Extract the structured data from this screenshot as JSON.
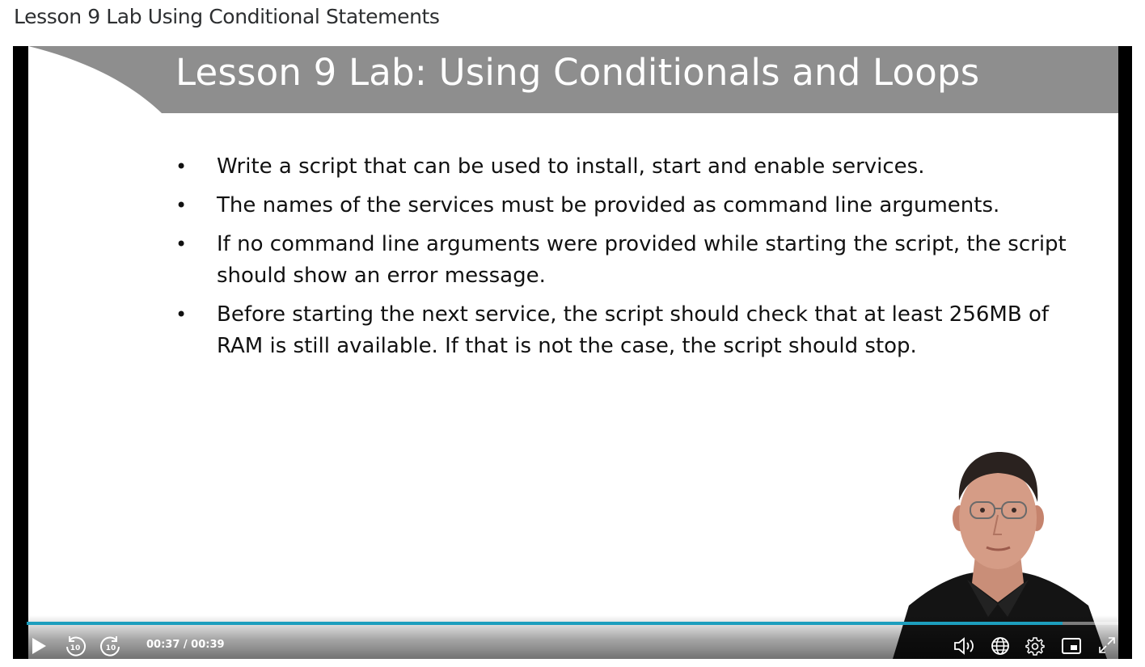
{
  "page": {
    "title": "Lesson 9 Lab Using Conditional Statements"
  },
  "slide": {
    "title": "Lesson 9 Lab: Using Conditionals and Loops",
    "bullets": [
      "Write a script that can be used to install, start and enable services.",
      "The names of the services must be provided as command line arguments.",
      "If no command line arguments were provided while starting the script, the script should show an error message.",
      "Before starting the next service, the script should check that at least 256MB of RAM is still available. If that is not the case, the script should stop."
    ],
    "bullet_glyph": "•"
  },
  "player": {
    "time_display": "00:37 / 00:39",
    "progress_fraction": 0.949,
    "accent_color": "#1d9ebd",
    "rewind_label": "10",
    "forward_label": "10",
    "icons": {
      "play": "play-icon",
      "rewind": "rewind-10-icon",
      "forward": "forward-10-icon",
      "volume": "volume-icon",
      "captions": "globe-icon",
      "settings": "gear-icon",
      "pip": "picture-in-picture-icon",
      "fullscreen": "expand-icon"
    }
  }
}
